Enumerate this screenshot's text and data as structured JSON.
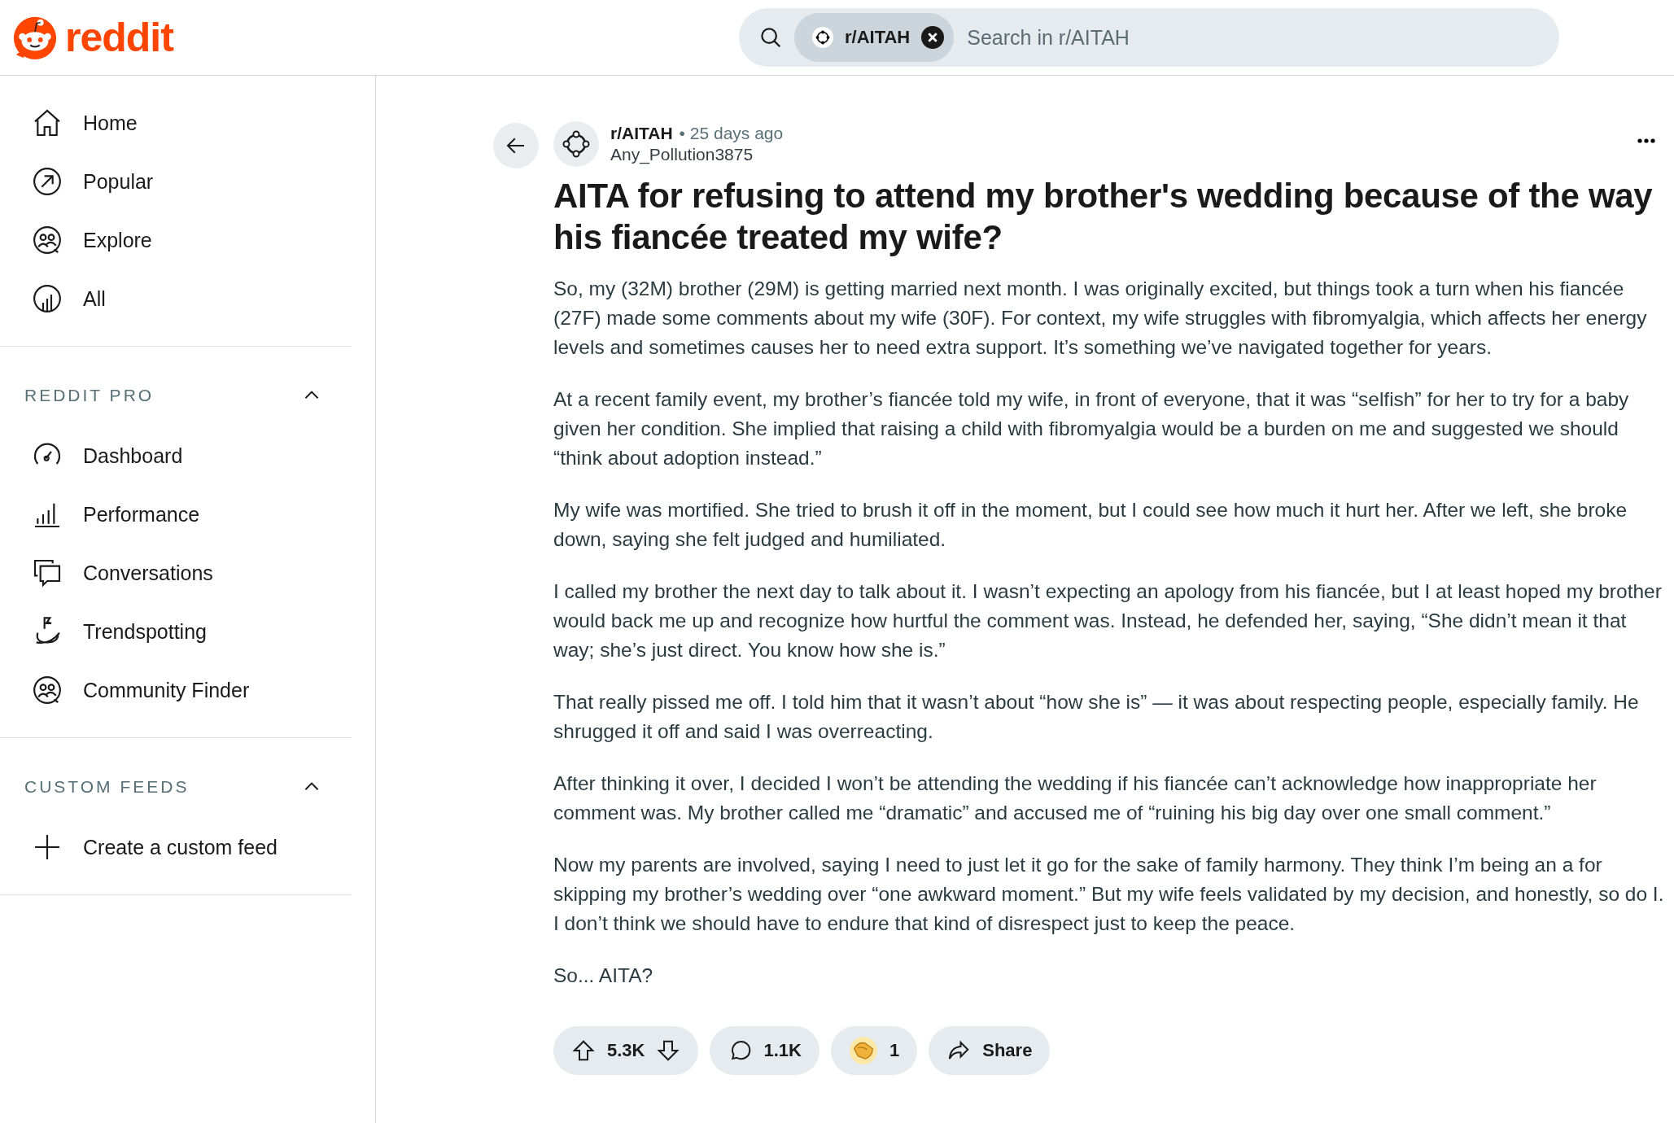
{
  "header": {
    "logo_text": "reddit",
    "search": {
      "chip": "r/AITAH",
      "placeholder": "Search in r/AITAH"
    }
  },
  "sidebar": {
    "items": [
      {
        "label": "Home"
      },
      {
        "label": "Popular"
      },
      {
        "label": "Explore"
      },
      {
        "label": "All"
      }
    ],
    "sections": [
      {
        "title": "REDDIT PRO",
        "expanded": true,
        "items": [
          {
            "label": "Dashboard"
          },
          {
            "label": "Performance"
          },
          {
            "label": "Conversations"
          },
          {
            "label": "Trendspotting"
          },
          {
            "label": "Community Finder"
          }
        ]
      },
      {
        "title": "CUSTOM FEEDS",
        "expanded": true,
        "items": [
          {
            "label": "Create a custom feed"
          }
        ]
      }
    ]
  },
  "post": {
    "subreddit": "r/AITAH",
    "time": "• 25 days ago",
    "author": "Any_Pollution3875",
    "title": "AITA for refusing to attend my brother's wedding because of the way his fiancée treated my wife?",
    "paragraphs": [
      "So, my (32M) brother (29M) is getting married next month. I was originally excited, but things took a turn when his fiancée (27F) made some comments about my wife (30F). For context, my wife struggles with fibromyalgia, which affects her energy levels and sometimes causes her to need extra support. It’s something we’ve navigated together for years.",
      "At a recent family event, my brother’s fiancée told my wife, in front of everyone, that it was “selfish” for her to try for a baby given her condition. She implied that raising a child with fibromyalgia would be a burden on me and suggested we should “think about adoption instead.”",
      "My wife was mortified. She tried to brush it off in the moment, but I could see how much it hurt her. After we left, she broke down, saying she felt judged and humiliated.",
      "I called my brother the next day to talk about it. I wasn’t expecting an apology from his fiancée, but I at least hoped my brother would back me up and recognize how hurtful the comment was. Instead, he defended her, saying, “She didn’t mean it that way; she’s just direct. You know how she is.”",
      "That really pissed me off. I told him that it wasn’t about “how she is” — it was about respecting people, especially family. He shrugged it off and said I was overreacting.",
      "After thinking it over, I decided I won’t be attending the wedding if his fiancée can’t acknowledge how inappropriate her comment was. My brother called me “dramatic” and accused me of “ruining his big day over one small comment.”",
      "Now my parents are involved, saying I need to just let it go for the sake of family harmony. They think I’m being an a for skipping my brother’s wedding over “one awkward moment.” But my wife feels validated by my decision, and honestly, so do I. I don’t think we should have to endure that kind of disrespect just to keep the peace.",
      "So... AITA?"
    ],
    "actions": {
      "votes": "5.3K",
      "comments": "1.1K",
      "awards": "1",
      "share": "Share"
    }
  }
}
